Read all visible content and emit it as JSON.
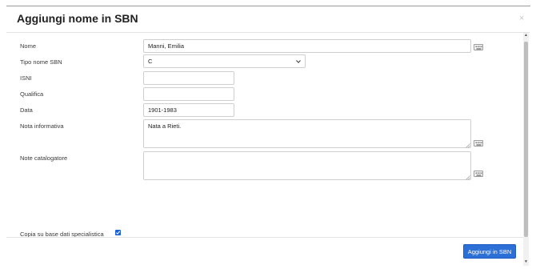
{
  "modal": {
    "title": "Aggiungi nome in SBN",
    "close_glyph": "×"
  },
  "form": {
    "nome": {
      "label": "Nome",
      "value": "Manni, Emilia",
      "icon": "keyboard-icon"
    },
    "tipo_nome": {
      "label": "Tipo nome SBN",
      "value": "C"
    },
    "isni": {
      "label": "ISNI",
      "value": ""
    },
    "qualifica": {
      "label": "Qualifica",
      "value": ""
    },
    "data": {
      "label": "Data",
      "value": "1901-1983"
    },
    "nota_informativa": {
      "label": "Nota informativa",
      "value": "Nata a Rieti.",
      "icon": "keyboard-icon"
    },
    "note_catalogatore": {
      "label": "Note catalogatore",
      "value": "",
      "icon": "keyboard-icon"
    },
    "copia": {
      "label": "Copia su base dati specialistica",
      "checked": true
    }
  },
  "footer": {
    "submit_label": "Aggiungi in SBN"
  },
  "colors": {
    "primary": "#2c6fd6",
    "border": "#cfcfcf"
  }
}
